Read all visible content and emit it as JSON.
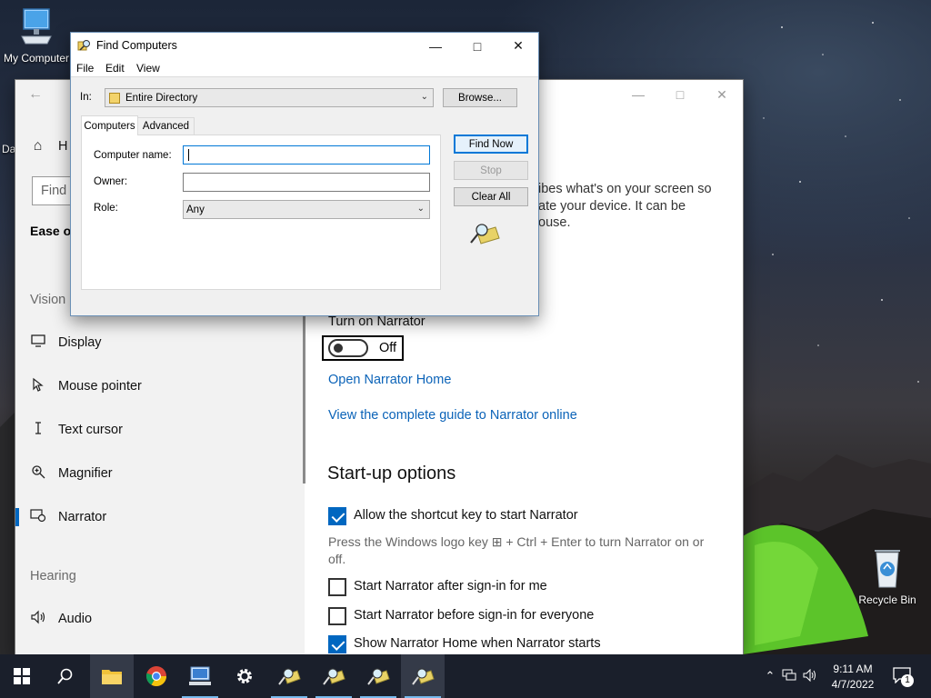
{
  "desktop": {
    "icons": [
      {
        "label": "My Computer"
      },
      {
        "label": "Recycle Bin"
      }
    ],
    "partial_label": "Da"
  },
  "settings": {
    "sidebar": {
      "home_partial": "H",
      "search_placeholder": "Find",
      "section_title_partial": "Ease of",
      "vision_header": "Vision",
      "hearing_header": "Hearing",
      "items": [
        {
          "label": "Display",
          "icon": "monitor-icon"
        },
        {
          "label": "Mouse pointer",
          "icon": "mouse-pointer-icon"
        },
        {
          "label": "Text cursor",
          "icon": "text-cursor-icon"
        },
        {
          "label": "Magnifier",
          "icon": "magnifier-icon"
        },
        {
          "label": "Narrator",
          "icon": "narrator-icon",
          "selected": true
        },
        {
          "label": "Audio",
          "icon": "speaker-icon"
        }
      ]
    },
    "content": {
      "desc_line1": "ibes what's on your screen so",
      "desc_line2": "ate your device. It can be",
      "desc_line3": "ouse.",
      "turn_on_label": "Turn on Narrator",
      "toggle_state": "Off",
      "link_home": "Open Narrator Home",
      "link_guide": "View the complete guide to Narrator online",
      "startup_title": "Start-up options",
      "opt_shortcut": "Allow the shortcut key to start Narrator",
      "shortcut_note": "Press the Windows logo key ⊞ + Ctrl + Enter to turn Narrator on or off.",
      "opt_after_signin": "Start Narrator after sign-in for me",
      "opt_before_signin": "Start Narrator before sign-in for everyone",
      "opt_show_home": "Show Narrator Home when Narrator starts"
    }
  },
  "find_dialog": {
    "title": "Find Computers",
    "menu": [
      "File",
      "Edit",
      "View"
    ],
    "in_label": "In:",
    "in_value": "Entire Directory",
    "browse": "Browse...",
    "tabs": [
      "Computers",
      "Advanced"
    ],
    "computer_name_label": "Computer name:",
    "computer_name_value": "",
    "owner_label": "Owner:",
    "owner_value": "",
    "role_label": "Role:",
    "role_value": "Any",
    "find_now": "Find Now",
    "stop": "Stop",
    "clear_all": "Clear All"
  },
  "taskbar": {
    "items": [
      "start-icon",
      "search-icon",
      "file-explorer-icon",
      "chrome-icon",
      "network-computer-icon",
      "gear-icon",
      "find-icon",
      "find-icon",
      "find-icon",
      "find-icon"
    ],
    "time": "9:11 AM",
    "date": "4/7/2022",
    "notification_count": "1"
  }
}
